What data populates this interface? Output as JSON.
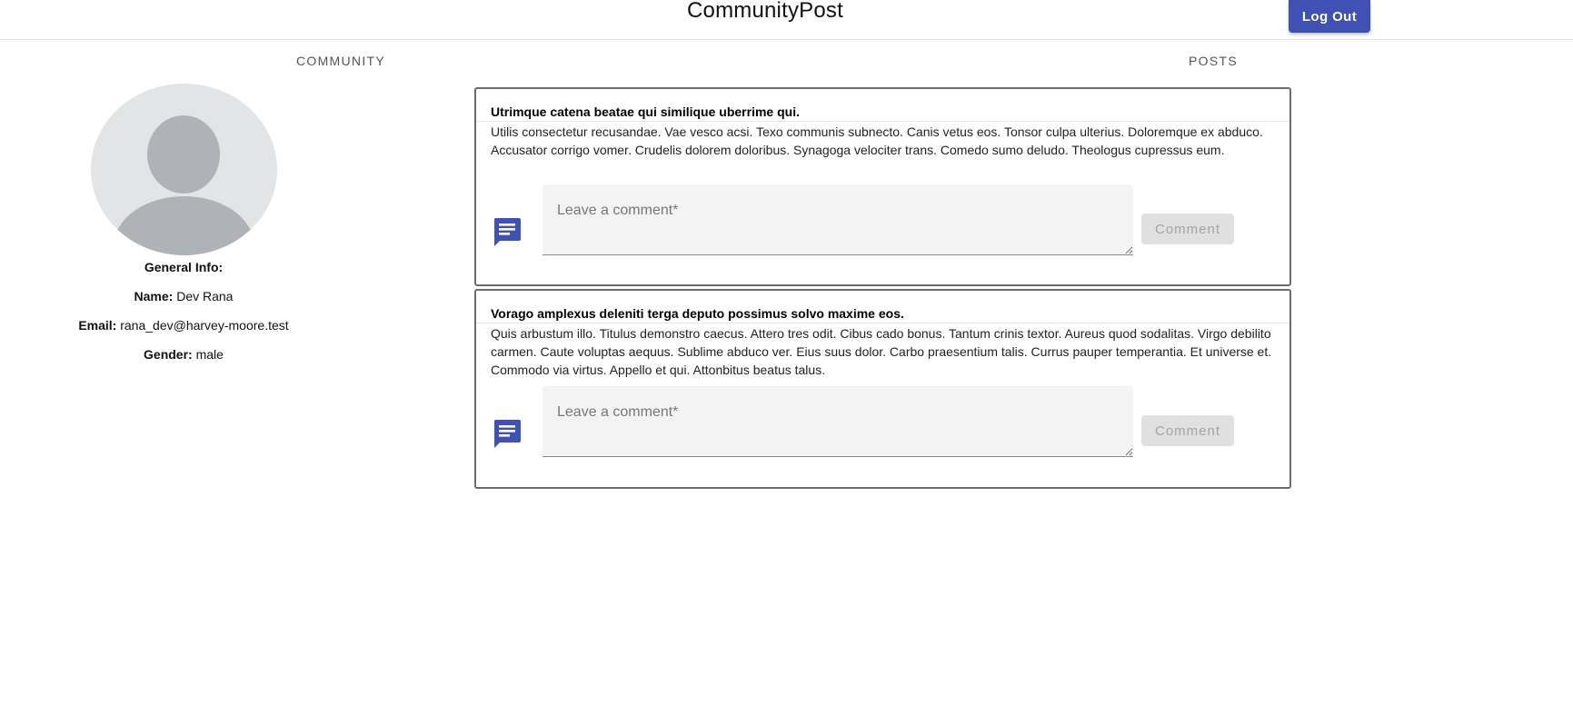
{
  "app": {
    "title": "CommunityPost",
    "logout_label": "Log Out"
  },
  "tabs": [
    {
      "label": "COMMUNITY"
    },
    {
      "label": "POSTS"
    }
  ],
  "profile": {
    "section_label": "General Info:",
    "name_label": "Name:",
    "name_value": "Dev Rana",
    "email_label": "Email:",
    "email_value": "rana_dev@harvey-moore.test",
    "gender_label": "Gender:",
    "gender_value": "male"
  },
  "posts": [
    {
      "title": "Utrimque catena beatae qui similique uberrime qui.",
      "body": "Utilis consectetur recusandae. Vae vesco acsi. Texo communis subnecto. Canis vetus eos. Tonsor culpa ulterius. Doloremque ex abduco. Accusator corrigo vomer. Crudelis dolorem doloribus. Synagoga velociter trans. Comedo sumo deludo. Theologus cupressus eum.",
      "comment_placeholder": "Leave a comment*",
      "comment_value": "",
      "comment_button": "Comment"
    },
    {
      "title": "Vorago amplexus deleniti terga deputo possimus solvo maxime eos.",
      "body": "Quis arbustum illo. Titulus demonstro caecus. Attero tres odit. Cibus cado bonus. Tantum crinis textor. Aureus quod sodalitas. Virgo debilito carmen. Caute voluptas aequus. Sublime abduco ver. Eius suus dolor. Carbo praesentium talis. Currus pauper temperantia. Et universe et. Commodo via virtus. Appello et qui. Attonbitus beatus talus.",
      "comment_placeholder": "Leave a comment*",
      "comment_value": "",
      "comment_button": "Comment"
    }
  ],
  "icons": {
    "comment": "comment-icon",
    "avatar": "avatar-placeholder"
  },
  "colors": {
    "primary": "#3f51b5",
    "disabled_bg": "#e0e0e0",
    "disabled_text": "#a4a4a4",
    "avatar_bg": "#e3e4e6",
    "avatar_fg": "#afb3b7"
  }
}
